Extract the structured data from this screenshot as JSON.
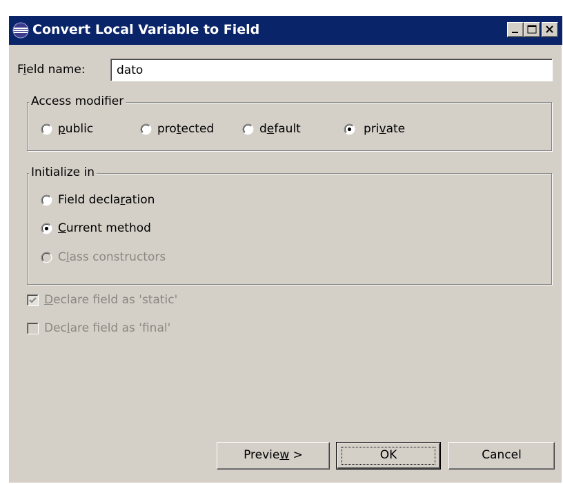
{
  "window": {
    "title": "Convert Local Variable to Field",
    "title_icon": "eclipse-icon"
  },
  "field_name": {
    "label_pre": "F",
    "label_mn": "i",
    "label_post": "eld name:",
    "value": "dato"
  },
  "access_modifier": {
    "legend": "Access modifier",
    "options": [
      {
        "pre": "",
        "mn": "p",
        "post": "ublic",
        "selected": false
      },
      {
        "pre": "pro",
        "mn": "t",
        "post": "ected",
        "selected": false
      },
      {
        "pre": "d",
        "mn": "e",
        "post": "fault",
        "selected": false
      },
      {
        "pre": "pri",
        "mn": "v",
        "post": "ate",
        "selected": true
      }
    ]
  },
  "initialize_in": {
    "legend": "Initialize in",
    "options": [
      {
        "pre": "Field decla",
        "mn": "r",
        "post": "ation",
        "selected": false,
        "enabled": true
      },
      {
        "pre": "",
        "mn": "C",
        "post": "urrent method",
        "selected": true,
        "enabled": true
      },
      {
        "pre": "C",
        "mn": "l",
        "post": "ass constructors",
        "selected": false,
        "enabled": false
      }
    ]
  },
  "checkboxes": [
    {
      "pre": "",
      "mn": "D",
      "post": "eclare field as 'static'",
      "checked": true,
      "enabled": false
    },
    {
      "pre": "Dec",
      "mn": "l",
      "post": "are field as 'final'",
      "checked": false,
      "enabled": false
    }
  ],
  "buttons": {
    "preview": {
      "pre": "Previe",
      "mn": "w",
      "post": " >"
    },
    "ok": "OK",
    "cancel": "Cancel"
  },
  "colors": {
    "titlebar": "#0a246a",
    "dialog_bg": "#d4d0c8",
    "disabled_text": "#8a8882"
  }
}
